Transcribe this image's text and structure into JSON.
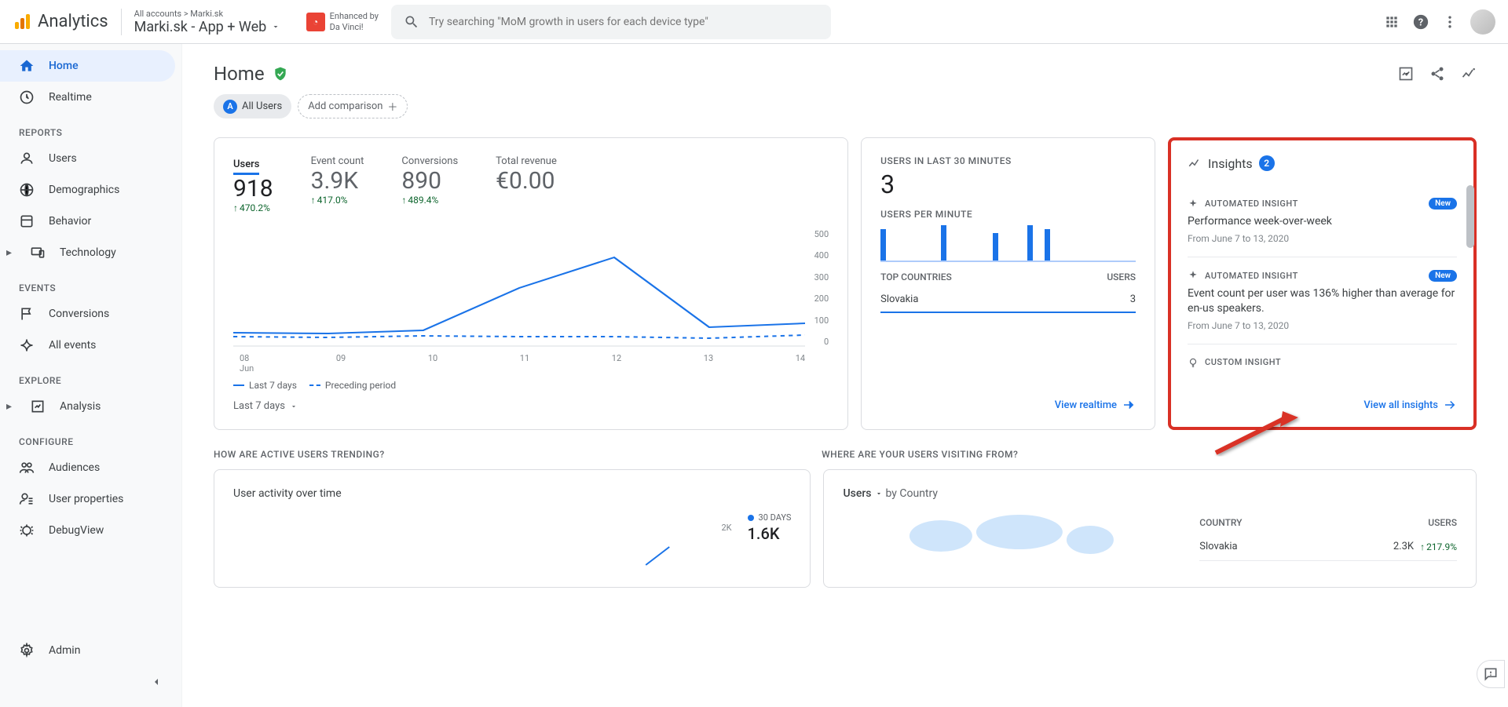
{
  "brand": "Analytics",
  "account_path": "All accounts > Marki.sk",
  "account_name": "Marki.sk - App + Web",
  "enhanced": "Enhanced by\nDa Vinci!",
  "search_placeholder": "Try searching \"MoM growth in users for each device type\"",
  "nav": {
    "home": "Home",
    "realtime": "Realtime",
    "reports_hdr": "REPORTS",
    "users": "Users",
    "demographics": "Demographics",
    "behavior": "Behavior",
    "technology": "Technology",
    "events_hdr": "EVENTS",
    "conversions": "Conversions",
    "all_events": "All events",
    "explore_hdr": "EXPLORE",
    "analysis": "Analysis",
    "configure_hdr": "CONFIGURE",
    "audiences": "Audiences",
    "user_props": "User properties",
    "debugview": "DebugView",
    "admin": "Admin"
  },
  "page_title": "Home",
  "chips": {
    "all_label": "All Users",
    "all_badge": "A",
    "add_label": "Add comparison"
  },
  "metrics": [
    {
      "label": "Users",
      "value": "918",
      "delta": "470.2%"
    },
    {
      "label": "Event count",
      "value": "3.9K",
      "delta": "417.0%"
    },
    {
      "label": "Conversions",
      "value": "890",
      "delta": "489.4%"
    },
    {
      "label": "Total revenue",
      "value": "€0.00",
      "delta": ""
    }
  ],
  "chart_data": {
    "type": "line",
    "x": [
      "08\nJun",
      "09",
      "10",
      "11",
      "12",
      "13",
      "14"
    ],
    "series": [
      {
        "name": "Last 7 days",
        "values": [
          60,
          55,
          70,
          250,
          380,
          85,
          100
        ],
        "style": "solid"
      },
      {
        "name": "Preceding period",
        "values": [
          45,
          42,
          48,
          46,
          45,
          40,
          50
        ],
        "style": "dashed"
      }
    ],
    "ylim": [
      0,
      500
    ],
    "yticks": [
      0,
      100,
      200,
      300,
      400,
      500
    ]
  },
  "chart_legend": {
    "a": "Last 7 days",
    "b": "Preceding period"
  },
  "chart_range": "Last 7 days",
  "realtime_card": {
    "hdr1": "USERS IN LAST 30 MINUTES",
    "val": "3",
    "hdr2": "USERS PER MINUTE",
    "bars": [
      40,
      0,
      0,
      0,
      0,
      0,
      0,
      45,
      0,
      0,
      0,
      0,
      0,
      35,
      0,
      0,
      0,
      45,
      0,
      40,
      0,
      0,
      0,
      0,
      0,
      0,
      0,
      0,
      0,
      0
    ],
    "top_hdr": "TOP COUNTRIES",
    "users_hdr": "USERS",
    "country": "Slovakia",
    "country_users": "3",
    "link": "View realtime"
  },
  "insights": {
    "title": "Insights",
    "count": "2",
    "items": [
      {
        "tag": "AUTOMATED INSIGHT",
        "new": "New",
        "title": "Performance week-over-week",
        "date": "From June 7 to 13, 2020"
      },
      {
        "tag": "AUTOMATED INSIGHT",
        "new": "New",
        "title": "Event count per user was 136% higher than average for en-us speakers.",
        "date": "From June 7 to 13, 2020"
      },
      {
        "tag": "CUSTOM INSIGHT",
        "new": "",
        "title": "",
        "date": ""
      }
    ],
    "link": "View all insights"
  },
  "section2_hdr": "HOW ARE ACTIVE USERS TRENDING?",
  "section3_hdr": "WHERE ARE YOUR USERS VISITING FROM?",
  "uaot": {
    "title": "User activity over time",
    "y2k": "2K",
    "d30": "30 DAYS",
    "d30v": "1.6K"
  },
  "geo": {
    "dropdown_a": "Users",
    "dropdown_b": "by Country",
    "col_a": "COUNTRY",
    "col_b": "USERS",
    "row_country": "Slovakia",
    "row_users": "2.3K",
    "row_delta": "217.9%"
  }
}
